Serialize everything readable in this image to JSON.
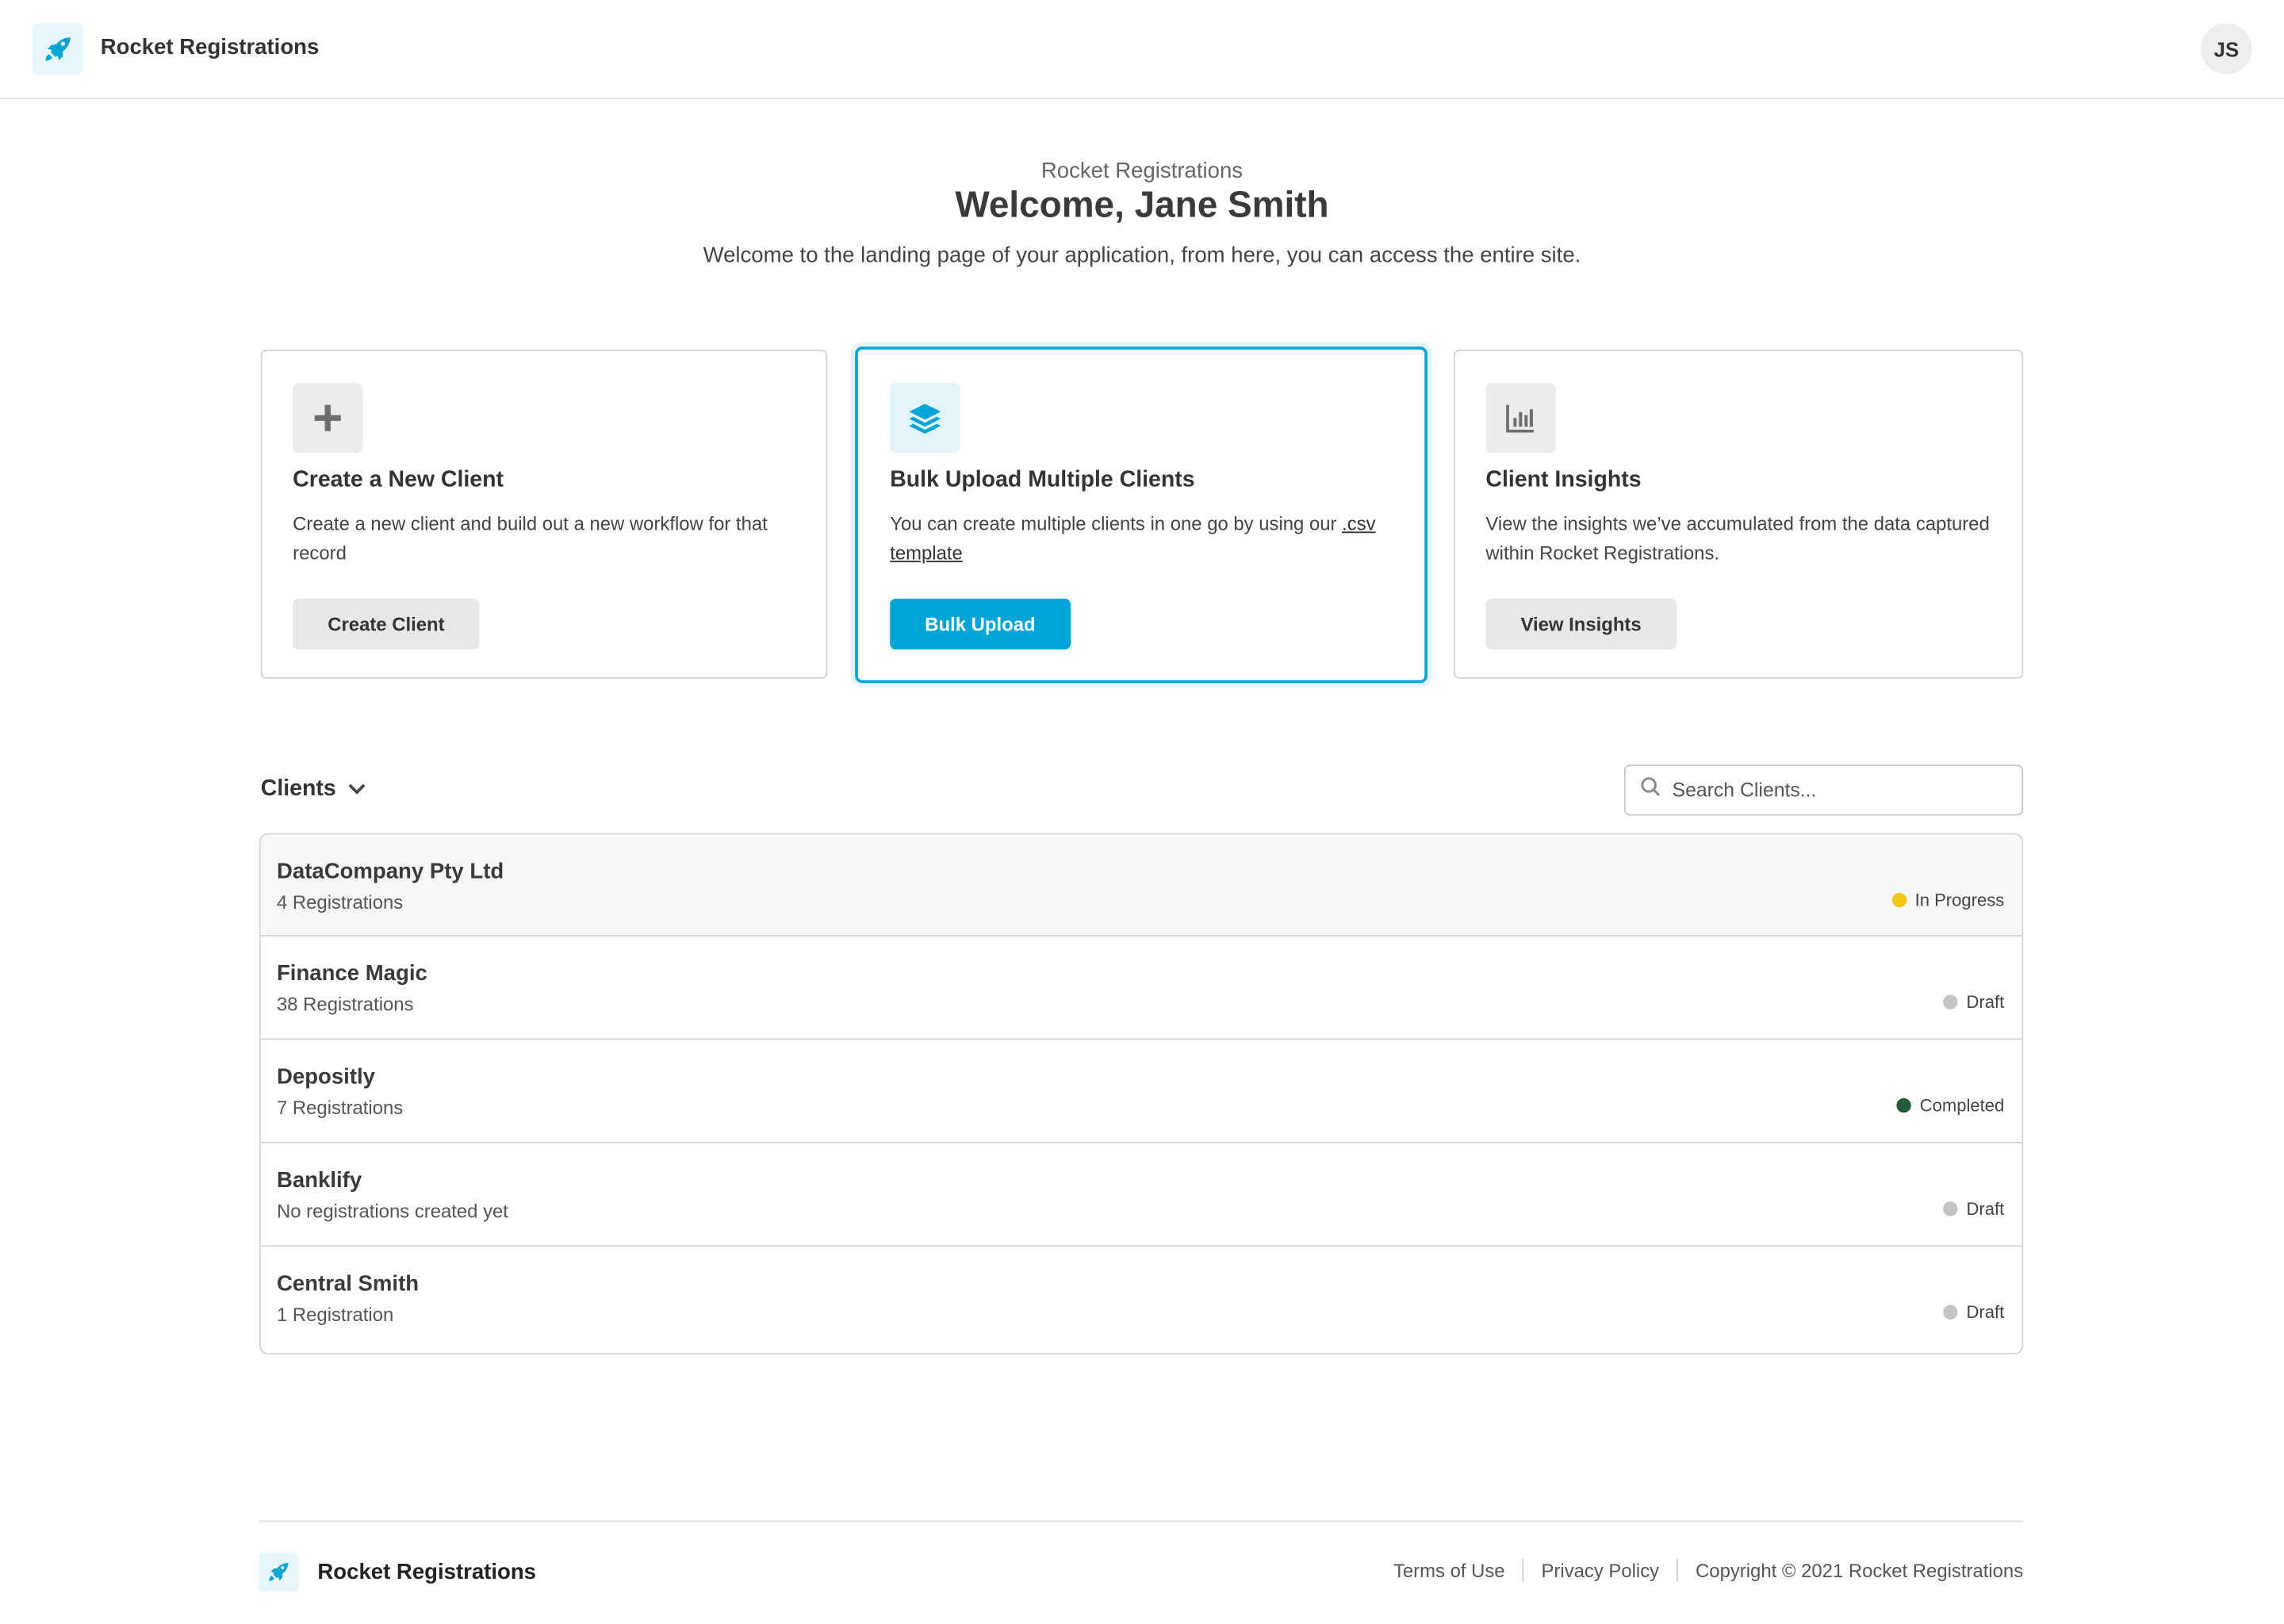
{
  "header": {
    "brand": "Rocket Registrations",
    "avatar_initials": "JS"
  },
  "hero": {
    "subtitle": "Rocket Registrations",
    "title": "Welcome, Jane Smith",
    "description": "Welcome to the landing page of your application, from here, you can access the entire site."
  },
  "cards": [
    {
      "icon": "plus-icon",
      "title": "Create a New Client",
      "description": "Create a new client and build out a new workflow for that record",
      "button": "Create Client"
    },
    {
      "icon": "layers-icon",
      "title": "Bulk Upload Multiple Clients",
      "description_prefix": "You can create multiple clients in one go by using our ",
      "description_link": ".csv template",
      "button": "Bulk Upload"
    },
    {
      "icon": "bar-chart-icon",
      "title": "Client Insights",
      "description": "View the insights we’ve accumulated from the data captured within Rocket Registrations.",
      "button": "View Insights"
    }
  ],
  "clients": {
    "label": "Clients",
    "search_placeholder": "Search Clients...",
    "rows": [
      {
        "name": "DataCompany Pty Ltd",
        "sub": "4 Registrations",
        "status": "In Progress",
        "status_color": "#f5c518"
      },
      {
        "name": "Finance Magic",
        "sub": "38 Registrations",
        "status": "Draft",
        "status_color": "#c4c4c4"
      },
      {
        "name": "Depositly",
        "sub": "7 Registrations",
        "status": "Completed",
        "status_color": "#1e5c3a"
      },
      {
        "name": "Banklify",
        "sub": "No registrations created yet",
        "status": "Draft",
        "status_color": "#c4c4c4"
      },
      {
        "name": "Central Smith",
        "sub": "1 Registration",
        "status": "Draft",
        "status_color": "#c4c4c4"
      }
    ]
  },
  "footer": {
    "brand": "Rocket Registrations",
    "terms": "Terms of Use",
    "privacy": "Privacy Policy",
    "copyright": "Copyright © 2021 Rocket Registrations"
  },
  "colors": {
    "accent": "#00a5d8"
  }
}
